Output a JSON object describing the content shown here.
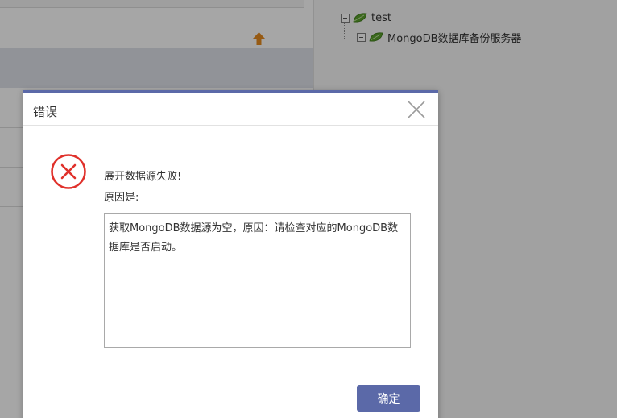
{
  "tree": {
    "root_label": "test",
    "child_label": "MongoDB数据库备份服务器",
    "leaf_icon": "leaf-icon",
    "leaf_color": "#5aa02c"
  },
  "toolbar": {
    "up_icon": "up-arrow-icon",
    "up_color": "#e68a1e"
  },
  "dialog": {
    "title": "错误",
    "close_icon": "close-icon",
    "error_icon": "error-circle-icon",
    "error_color": "#e0312b",
    "message_line1": "展开数据源失败!",
    "message_line2": "原因是:",
    "detail": "获取MongoDB数据源为空，原因：请检查对应的MongoDB数据库是否启动。",
    "ok_label": "确定",
    "accent_color": "#5b69a8"
  }
}
